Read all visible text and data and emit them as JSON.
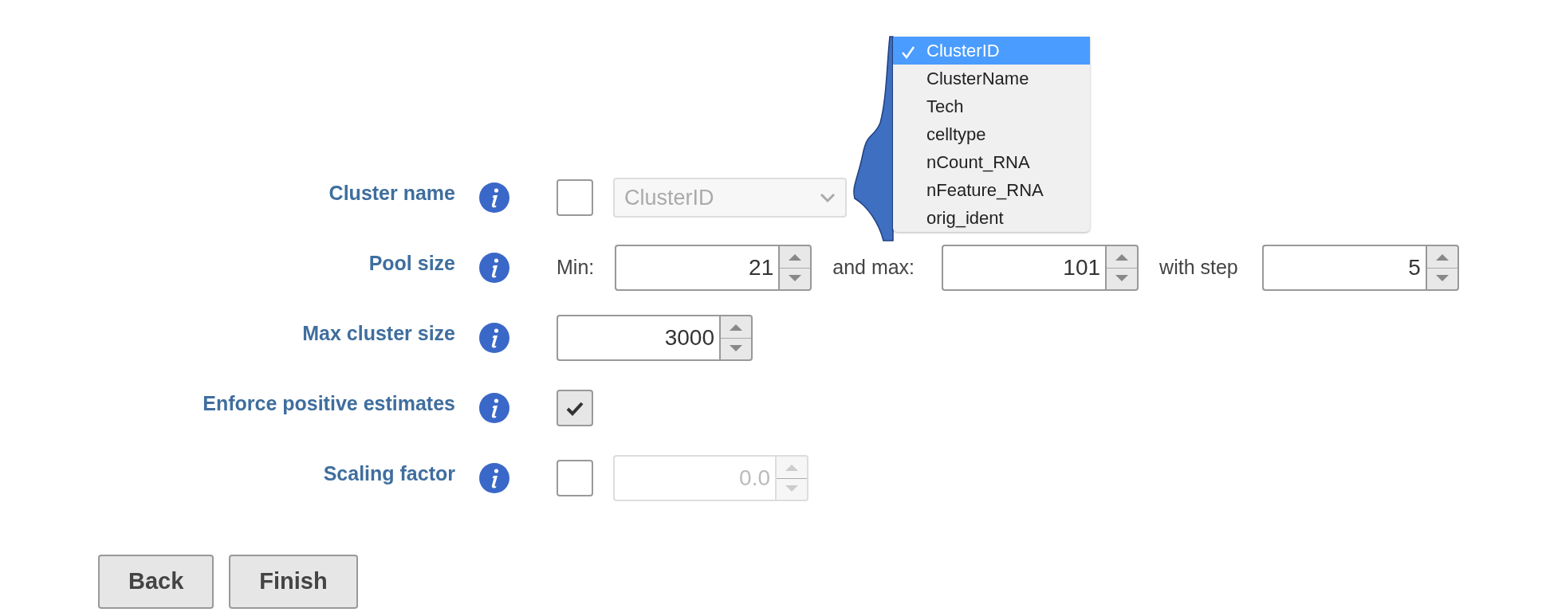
{
  "fields": [
    {
      "kind": "checkbox-select",
      "label": "Cluster name",
      "checked": false,
      "select": {
        "value": "ClusterID",
        "disabled": true
      }
    },
    {
      "kind": "range",
      "label": "Pool size",
      "parts": [
        {
          "prefix": "Min:",
          "value": "21"
        },
        {
          "prefix": "and max:",
          "value": "101"
        },
        {
          "prefix": "with step",
          "value": "5"
        }
      ]
    },
    {
      "kind": "number",
      "label": "Max cluster size",
      "value": "3000"
    },
    {
      "kind": "checkbox",
      "label": "Enforce positive estimates",
      "checked": true
    },
    {
      "kind": "checkbox-number",
      "label": "Scaling factor",
      "checked": false,
      "number": {
        "value": "0.0",
        "disabled": true
      }
    }
  ],
  "dropdown": {
    "options": [
      {
        "label": "ClusterID",
        "selected": true
      },
      {
        "label": "ClusterName",
        "selected": false
      },
      {
        "label": "Tech",
        "selected": false
      },
      {
        "label": "celltype",
        "selected": false
      },
      {
        "label": "nCount_RNA",
        "selected": false
      },
      {
        "label": "nFeature_RNA",
        "selected": false
      },
      {
        "label": "orig_ident",
        "selected": false
      }
    ]
  },
  "buttons": [
    "Back",
    "Finish"
  ]
}
